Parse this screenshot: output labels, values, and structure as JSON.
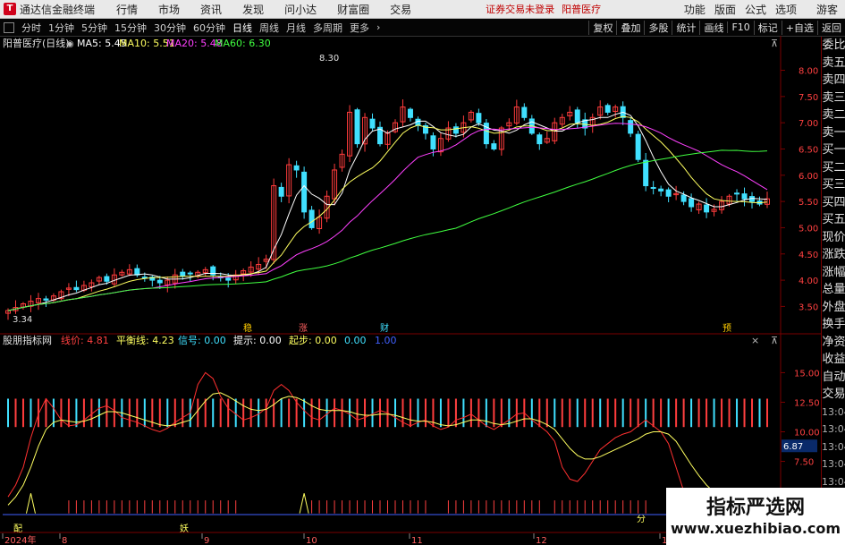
{
  "menu": {
    "app_title": "通达信金融终端",
    "items": [
      "行情",
      "市场",
      "资讯",
      "发现",
      "问小达",
      "财富圈",
      "交易"
    ],
    "notice": "证券交易未登录",
    "stock_name": "阳普医疗",
    "right_items": [
      "功能",
      "版面",
      "公式",
      "选项"
    ],
    "guest": "游客"
  },
  "toolbar": {
    "periods": [
      "分时",
      "1分钟",
      "5分钟",
      "15分钟",
      "30分钟",
      "60分钟",
      "日线",
      "周线",
      "月线",
      "多周期",
      "更多"
    ],
    "active": "日线",
    "right_buttons": [
      "复权",
      "叠加",
      "多股",
      "统计",
      "画线",
      "F10",
      "标记",
      "+自选",
      "返回"
    ]
  },
  "side_panel": {
    "items": [
      "委比",
      "卖五",
      "卖四",
      "卖三",
      "卖二",
      "卖一",
      "买一",
      "买二",
      "买三",
      "买四",
      "买五",
      "现价",
      "涨跌",
      "涨幅",
      "总量",
      "外盘",
      "换手",
      "净资",
      "收益",
      "自动",
      "交易"
    ],
    "times": [
      "13:04",
      "13:04",
      "13:04",
      "13:04",
      "13:04",
      "13:05",
      "13:05"
    ]
  },
  "legend_main": {
    "title": "阳普医疗(日线)",
    "ma5": "MA5: 5.45",
    "ma10": "MA10: 5.51",
    "ma20": "MA20: 5.48",
    "ma60": "MA60: 6.30"
  },
  "legend_ind": {
    "title": "股朋指标网",
    "items": [
      {
        "text": "线价: 4.81",
        "color": "#ff4040"
      },
      {
        "text": "平衡线: 4.23",
        "color": "#ffff60"
      },
      {
        "text": "信号: 0.00",
        "color": "#40e0ff"
      },
      {
        "text": "提示: 0.00",
        "color": "#ffffff"
      },
      {
        "text": "起步: 0.00",
        "color": "#ffff60"
      },
      {
        "text": "0.00",
        "color": "#40e0ff"
      },
      {
        "text": "1.00",
        "color": "#4060ff"
      }
    ]
  },
  "markers": {
    "high": "8.30",
    "low": "3.34",
    "events": [
      "稳",
      "涨",
      "财",
      "预"
    ],
    "bottom_labels": [
      "配",
      "妖",
      "分"
    ]
  },
  "watermark": {
    "line1": "指标严选网",
    "line2": "www.xuezhibiao.com"
  },
  "colors": {
    "up": "#ff3c3c",
    "down": "#40e0ff",
    "ma5": "#ffffff",
    "ma10": "#ffff60",
    "ma20": "#ff40ff",
    "ma60": "#40ff40",
    "axis": "#7a0000"
  },
  "chart_data": [
    {
      "type": "candlestick",
      "title": "阳普医疗(日线)",
      "x_ticks": [
        "2024年",
        "8",
        "9",
        "10",
        "11",
        "12",
        "1"
      ],
      "y_ticks": [
        3.5,
        4.0,
        4.5,
        5.0,
        5.5,
        6.0,
        6.5,
        7.0,
        7.5,
        8.0
      ],
      "ylim": [
        3.2,
        8.35
      ],
      "high_label": 8.3,
      "low_label": 3.34,
      "closes": [
        3.42,
        3.48,
        3.55,
        3.6,
        3.65,
        3.62,
        3.7,
        3.78,
        3.85,
        3.82,
        3.9,
        3.95,
        4.05,
        3.98,
        4.1,
        4.15,
        4.2,
        4.1,
        4.05,
        4.0,
        3.95,
        4.0,
        4.1,
        4.08,
        4.12,
        4.15,
        4.2,
        4.1,
        4.05,
        4.0,
        4.1,
        4.18,
        4.25,
        4.3,
        4.4,
        5.8,
        5.6,
        6.2,
        6.1,
        5.3,
        5.0,
        5.2,
        5.6,
        6.1,
        6.4,
        7.2,
        6.6,
        7.1,
        6.9,
        6.6,
        6.8,
        7.0,
        7.3,
        7.1,
        6.95,
        6.8,
        6.5,
        6.7,
        6.9,
        6.8,
        7.0,
        7.2,
        7.0,
        6.6,
        6.5,
        6.9,
        7.0,
        7.3,
        7.1,
        6.8,
        6.6,
        6.7,
        7.0,
        7.1,
        7.2,
        7.0,
        6.9,
        7.1,
        7.3,
        7.2,
        7.3,
        7.1,
        6.8,
        6.3,
        5.8,
        5.75,
        5.7,
        5.6,
        5.65,
        5.5,
        5.4,
        5.45,
        5.3,
        5.35,
        5.5,
        5.6,
        5.65,
        5.55,
        5.5,
        5.45,
        5.55
      ],
      "ma_legend": {
        "MA5": 5.45,
        "MA10": 5.51,
        "MA20": 5.48,
        "MA60": 6.3
      }
    },
    {
      "type": "line",
      "title": "股朋指标网",
      "y_ticks": [
        5.0,
        7.5,
        10.0,
        12.5,
        15.0
      ],
      "ylim": [
        3.0,
        17.0
      ],
      "series": [
        {
          "name": "线价",
          "values": [
            4.5,
            5.5,
            7.0,
            9.5,
            11.5,
            12.8,
            12.0,
            11.0,
            10.5,
            10.6,
            11.0,
            11.5,
            12.0,
            12.2,
            11.8,
            11.2,
            11.0,
            10.8,
            10.5,
            10.2,
            10.0,
            10.3,
            10.8,
            11.2,
            11.6,
            14.0,
            15.0,
            14.5,
            13.0,
            12.0,
            11.5,
            11.0,
            11.2,
            11.5,
            12.0,
            13.5,
            14.0,
            13.5,
            12.5,
            11.8,
            11.2,
            11.0,
            11.5,
            12.0,
            11.8,
            11.5,
            11.0,
            11.2,
            11.5,
            11.8,
            11.6,
            11.2,
            10.8,
            10.5,
            10.8,
            11.0,
            10.5,
            10.2,
            10.4,
            11.0,
            11.2,
            11.5,
            11.0,
            10.5,
            10.2,
            10.6,
            11.0,
            11.5,
            11.6,
            11.0,
            10.5,
            10.0,
            9.2,
            7.0,
            6.0,
            5.8,
            6.5,
            7.5,
            8.5,
            9.0,
            9.5,
            9.8,
            10.0,
            10.5,
            11.0,
            10.5,
            10.0,
            9.0,
            7.0,
            5.0,
            4.0,
            3.5,
            3.2,
            3.3,
            3.4,
            3.6,
            3.8,
            4.0,
            4.3,
            4.5,
            4.81
          ]
        },
        {
          "name": "平衡线",
          "values": [
            3.8,
            4.5,
            5.5,
            7.0,
            8.8,
            10.2,
            10.8,
            11.0,
            10.9,
            10.8,
            10.9,
            11.1,
            11.4,
            11.7,
            11.7,
            11.6,
            11.4,
            11.2,
            11.0,
            10.8,
            10.6,
            10.5,
            10.6,
            10.8,
            11.0,
            11.8,
            12.6,
            13.2,
            13.3,
            13.0,
            12.6,
            12.2,
            11.9,
            11.8,
            11.9,
            12.3,
            12.8,
            13.0,
            12.9,
            12.6,
            12.2,
            11.9,
            11.8,
            11.8,
            11.8,
            11.7,
            11.5,
            11.4,
            11.4,
            11.5,
            11.5,
            11.4,
            11.2,
            11.0,
            10.9,
            10.9,
            10.8,
            10.6,
            10.5,
            10.6,
            10.8,
            11.0,
            11.0,
            10.9,
            10.7,
            10.6,
            10.7,
            10.9,
            11.1,
            11.1,
            10.9,
            10.6,
            10.2,
            9.4,
            8.6,
            8.0,
            7.7,
            7.7,
            7.9,
            8.2,
            8.5,
            8.8,
            9.1,
            9.4,
            9.8,
            10.0,
            10.0,
            9.8,
            9.2,
            8.2,
            7.2,
            6.3,
            5.5,
            4.9,
            4.5,
            4.3,
            4.2,
            4.2,
            4.2,
            4.2,
            4.23
          ]
        }
      ]
    }
  ]
}
